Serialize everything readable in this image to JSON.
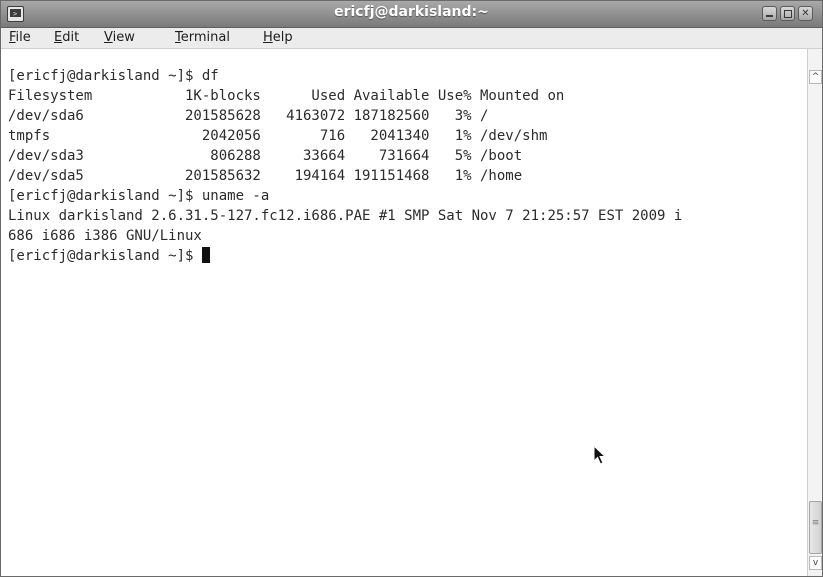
{
  "window": {
    "title": "ericfj@darkisland:~",
    "title_color": "#ffffff",
    "titlebar_color": "#8e8e8e",
    "icon": "terminal-icon",
    "controls": [
      "minimize-icon",
      "maximize-icon",
      "close-icon"
    ]
  },
  "menu": [
    {
      "pre": "",
      "acc": "F",
      "post": "ile"
    },
    {
      "pre": "",
      "acc": "E",
      "post": "dit"
    },
    {
      "pre": "",
      "acc": "V",
      "post": "iew"
    },
    {
      "pre": "",
      "acc": "T",
      "post": "erminal"
    },
    {
      "pre": "",
      "acc": "H",
      "post": "elp"
    }
  ],
  "terminal": {
    "background": "#ffffff",
    "foreground": "#2b2b2b",
    "lines": [
      "[ericfj@darkisland ~]$ df",
      "Filesystem           1K-blocks      Used Available Use% Mounted on",
      "/dev/sda6            201585628   4163072 187182560   3% /",
      "tmpfs                  2042056       716   2041340   1% /dev/shm",
      "/dev/sda3               806288     33664    731664   5% /boot",
      "/dev/sda5            201585632    194164 191151468   1% /home",
      "[ericfj@darkisland ~]$ uname -a",
      "Linux darkisland 2.6.31.5-127.fc12.i686.PAE #1 SMP Sat Nov 7 21:25:57 EST 2009 i",
      "686 i686 i386 GNU/Linux"
    ],
    "prompt": "[ericfj@darkisland ~]$ "
  },
  "scrollbar": {
    "up_icon": "chevron-up-icon",
    "down_icon": "chevron-down-icon",
    "thumb_grip": "≡"
  }
}
